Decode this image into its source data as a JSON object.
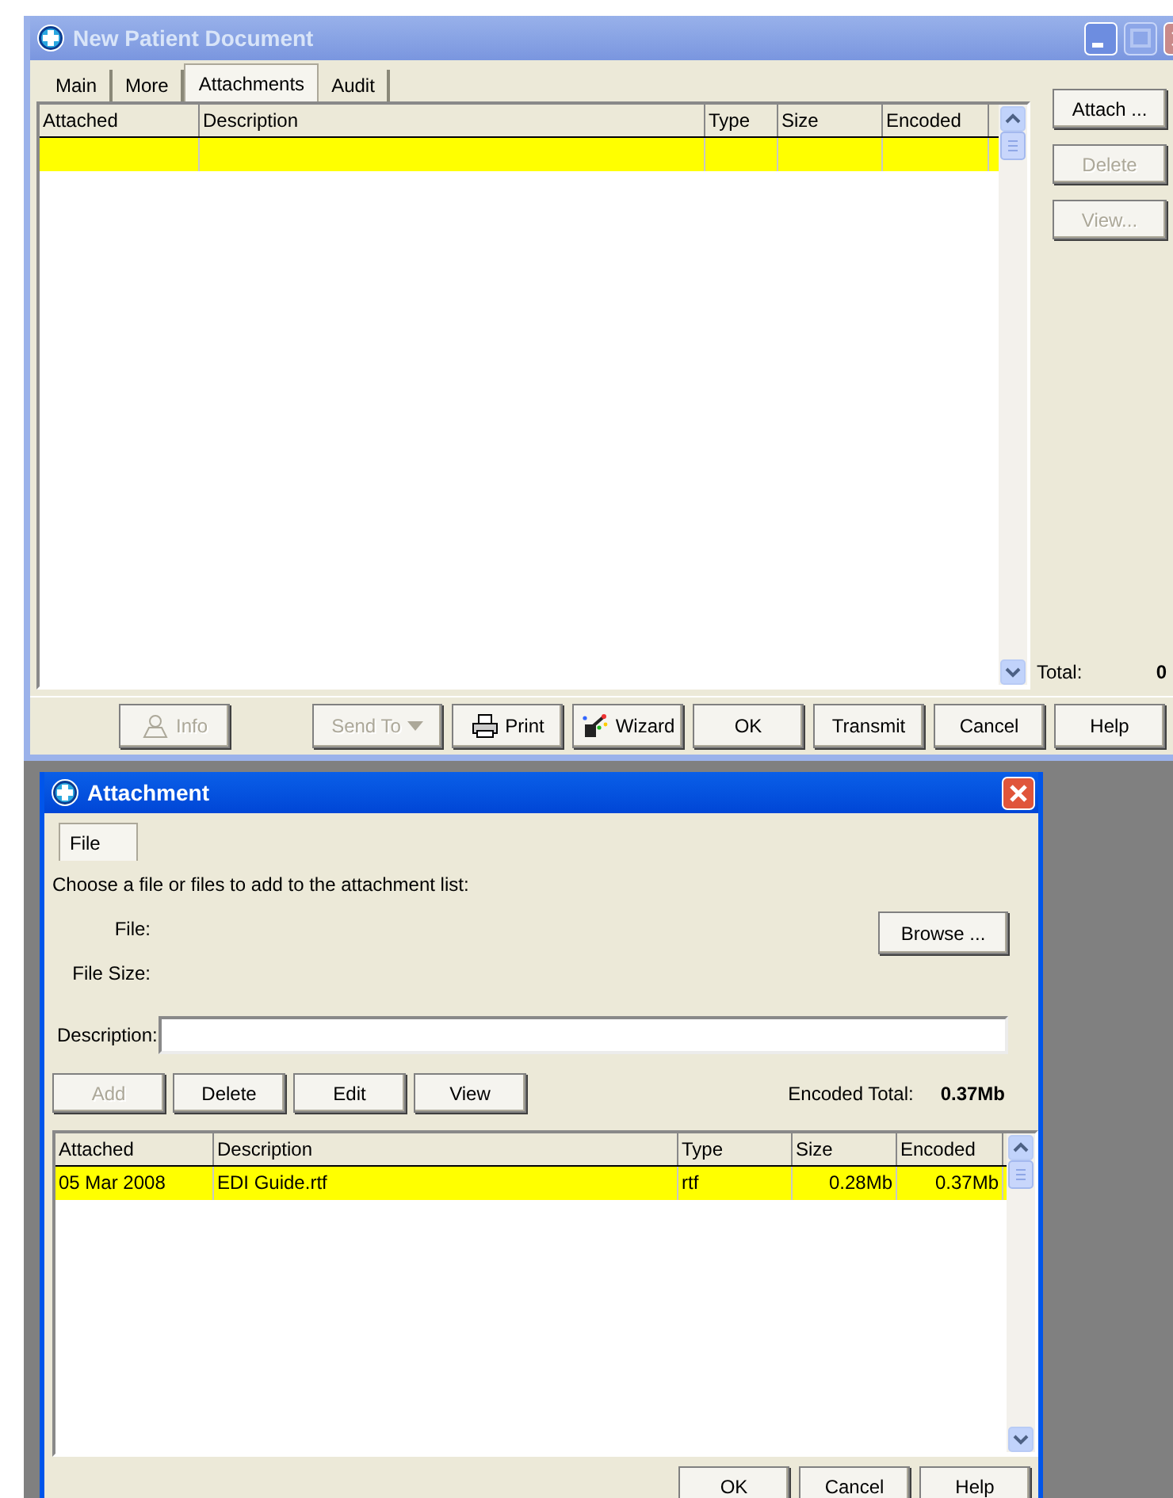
{
  "main_window": {
    "title": "New Patient Document",
    "active": false,
    "tabs": [
      {
        "label": "Main",
        "selected": false
      },
      {
        "label": "More",
        "selected": false
      },
      {
        "label": "Attachments",
        "selected": true
      },
      {
        "label": "Audit",
        "selected": false
      }
    ],
    "table": {
      "columns": [
        "Attached",
        "Description",
        "Type",
        "Size",
        "Encoded"
      ],
      "rows": [
        {
          "cells": [],
          "selected": true
        }
      ]
    },
    "side_buttons": [
      {
        "label": "Attach ...",
        "disabled": false
      },
      {
        "label": "Delete",
        "disabled": true
      },
      {
        "label": "View...",
        "disabled": true
      }
    ],
    "total_label": "Total:",
    "total_value": "0",
    "buttons": [
      {
        "label": "Info",
        "kind": "info",
        "disabled": true
      },
      {
        "label": "Send To",
        "kind": "dropdown",
        "disabled": true
      },
      {
        "label": "Print",
        "kind": "print",
        "disabled": false
      },
      {
        "label": "Wizard",
        "kind": "wizard",
        "disabled": false
      },
      {
        "label": "OK",
        "kind": "plain",
        "disabled": false
      },
      {
        "label": "Transmit",
        "kind": "plain",
        "disabled": false
      },
      {
        "label": "Cancel",
        "kind": "plain",
        "disabled": false
      },
      {
        "label": "Help",
        "kind": "plain",
        "disabled": false
      }
    ]
  },
  "dialog": {
    "title": "Attachment",
    "active": true,
    "tabs": [
      {
        "label": "File",
        "selected": true
      }
    ],
    "instruction": "Choose a file or files to add to the attachment list:",
    "file_label": "File:",
    "file_size_label": "File Size:",
    "browse_button": "Browse ...",
    "description_label": "Description:",
    "actions": [
      {
        "label": "Add",
        "disabled": true
      },
      {
        "label": "Delete",
        "disabled": false
      },
      {
        "label": "Edit",
        "disabled": false
      },
      {
        "label": "View",
        "disabled": false
      }
    ],
    "encoded_total_label": "Encoded Total:",
    "encoded_total_value": "0.37Mb",
    "table": {
      "columns": [
        "Attached",
        "Description",
        "Type",
        "Size",
        "Encoded"
      ],
      "rows": [
        {
          "cells": [
            "05 Mar 2008",
            "EDI Guide.rtf",
            "rtf",
            "0.28Mb",
            "0.37Mb"
          ],
          "selected": true
        }
      ]
    },
    "buttons": [
      {
        "label": "OK",
        "disabled": false
      },
      {
        "label": "Cancel",
        "disabled": false
      },
      {
        "label": "Help",
        "disabled": false
      }
    ]
  }
}
